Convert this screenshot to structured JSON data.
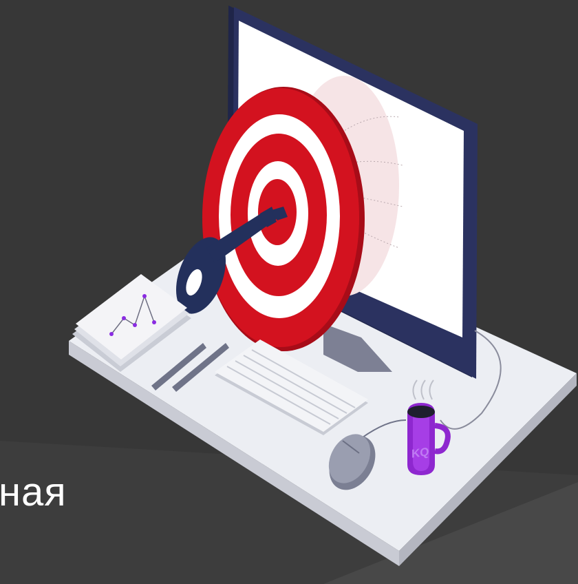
{
  "caption": {
    "text": "ная"
  },
  "mug": {
    "logo_text": "KQ"
  },
  "colors": {
    "background": "#373737",
    "background_lower": "#4a4a4a",
    "desk": "#ecedf2",
    "target_red": "#d0101f",
    "key_navy": "#23305c",
    "mug_purple": "#9a2bd8",
    "monitor_frame": "#272d55"
  }
}
